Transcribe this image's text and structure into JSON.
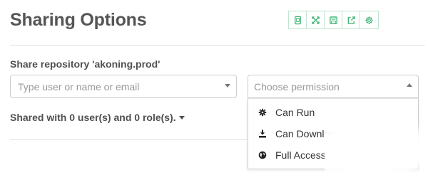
{
  "header": {
    "title": "Sharing Options",
    "toolbar": [
      {
        "name": "copy-icon"
      },
      {
        "name": "expand-icon"
      },
      {
        "name": "save-icon"
      },
      {
        "name": "share-icon"
      },
      {
        "name": "gear-icon"
      }
    ],
    "accent_color": "#3cb371"
  },
  "share": {
    "label": "Share repository 'akoning.prod'",
    "user_input": {
      "value": "",
      "placeholder": "Type user or name or email"
    },
    "permission_select": {
      "placeholder": "Choose permission",
      "options": [
        {
          "label": "Can Run",
          "icon": "gear-icon"
        },
        {
          "label": "Can Downloa",
          "icon": "download-icon"
        },
        {
          "label": "Full Access",
          "icon": "globe-icon"
        }
      ]
    }
  },
  "shared_with": {
    "label": "Shared with 0 user(s) and 0 role(s)."
  }
}
